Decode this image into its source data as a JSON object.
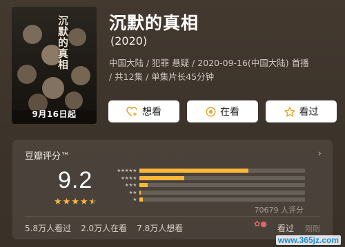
{
  "poster": {
    "date_label": "9月16日起",
    "title_stamp": "沉默的真相"
  },
  "header": {
    "title": "沉默的真相",
    "year": "(2020)",
    "meta_line1": "中国大陆 / 犯罪 悬疑 / 2020-09-16(中国大陆) 首播",
    "meta_line2": "/ 共12集 / 单集片长45分钟"
  },
  "actions": [
    {
      "label": "想看",
      "icon": "heart-plus-icon"
    },
    {
      "label": "在看",
      "icon": "target-icon"
    },
    {
      "label": "看过",
      "icon": "star-outline-icon"
    }
  ],
  "rating": {
    "title": "豆瓣评分™",
    "score": "9.2",
    "score_stars": 4.5,
    "votes": "70679 人评分",
    "distribution": [
      {
        "stars": 5,
        "fraction": 0.66
      },
      {
        "stars": 4,
        "fraction": 0.27
      },
      {
        "stars": 3,
        "fraction": 0.05
      },
      {
        "stars": 2,
        "fraction": 0.01
      },
      {
        "stars": 1,
        "fraction": 0.02
      }
    ],
    "stats": [
      "5.8万人看过",
      "2.0万人在看",
      "7.8万人想看"
    ]
  },
  "overlay": {
    "label": "看过",
    "sub": "刚刚",
    "watermark": "www.365jz.com"
  },
  "colors": {
    "accent": "#fdb83a",
    "background": "#3d342b"
  }
}
